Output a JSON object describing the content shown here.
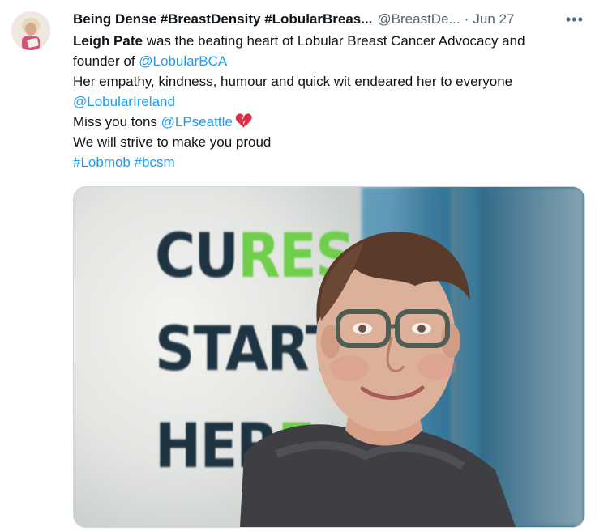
{
  "tweet": {
    "author_name": "Being Dense #BreastDensity #LobularBreas...",
    "author_handle": "@BreastDe...",
    "separator": "·",
    "date": "Jun 27",
    "more_label": "•••",
    "lines": {
      "line1_mention": "Leigh Pate",
      "line1_text": " was the beating heart of Lobular Breast Cancer Advocacy and",
      "line2_text": "founder of ",
      "line2_mention": "@LobularBCA",
      "line3_text": "Her empathy, kindness, humour and quick wit endeared her to everyone",
      "line4_mention": "@LobularIreland",
      "line5_text": "Miss you tons ",
      "line5_mention": "@LPseattle",
      "line6_text": "We will strive to make you proud",
      "line7_hashtag1": "#Lobmob",
      "line7_hashtag2": "#bcsm"
    }
  },
  "media": {
    "sign_line1_dark": "CU",
    "sign_line1_green": "RES",
    "sign_line2_dark": "START",
    "sign_line3_dark": "HER",
    "sign_line3_green": "E"
  },
  "colors": {
    "link": "#1d9bf0",
    "secondary_text": "#536471",
    "heart": "#e0245e"
  },
  "icons": [
    "avatar-icon",
    "more-icon",
    "broken-heart-icon"
  ]
}
